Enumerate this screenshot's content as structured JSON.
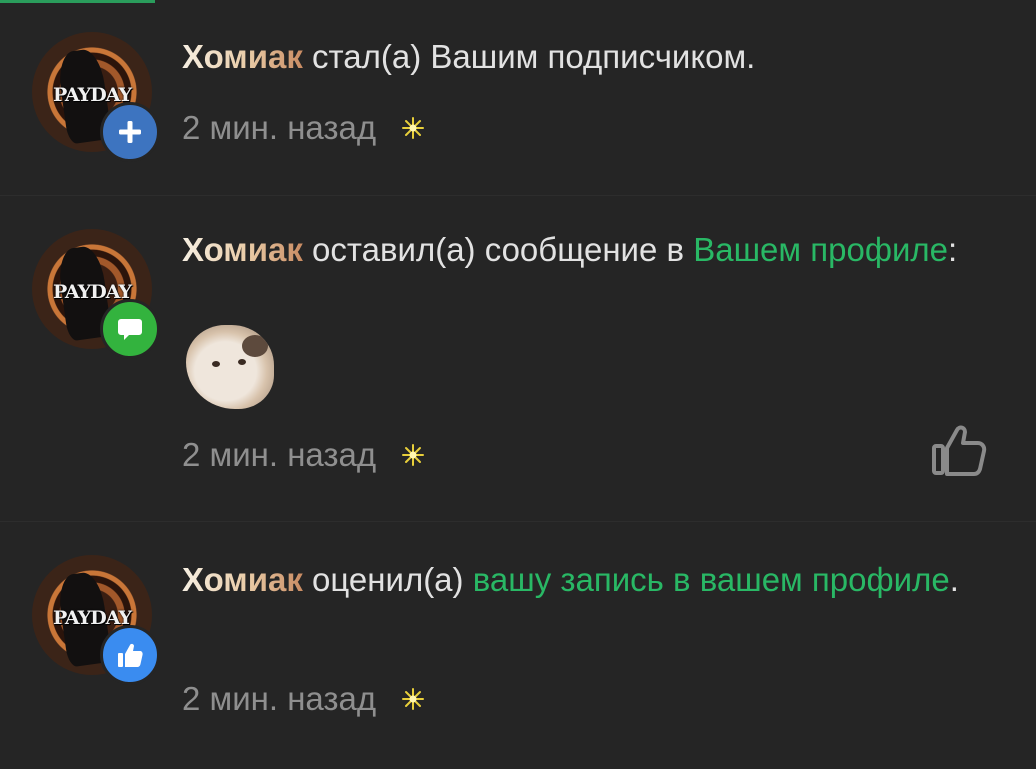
{
  "colors": {
    "background": "#252525",
    "link": "#29b865",
    "meta_text": "#8f8f8f",
    "follow_badge": "#3d74c0",
    "message_badge": "#33b33e",
    "like_badge": "#3a8cf0"
  },
  "notifications": [
    {
      "avatar_logo": "PAYDAY",
      "badge_icon": "plus-icon",
      "username": "Хомиак",
      "text": " стал(а) Вашим подписчиком.",
      "time": "2 мин. назад",
      "time_icon": "sparkle-icon"
    },
    {
      "avatar_logo": "PAYDAY",
      "badge_icon": "speech-bubble-icon",
      "username": "Хомиак",
      "text": " оставил(а) сообщение в ",
      "link_text": "Вашем профиле",
      "suffix": ":",
      "attachment": "hamster-sticker",
      "time": "2 мин. назад",
      "time_icon": "sparkle-icon",
      "action_icon": "thumbs-up-outline-icon"
    },
    {
      "avatar_logo": "PAYDAY",
      "badge_icon": "thumbs-up-icon",
      "username": "Хомиак",
      "text": " оценил(а) ",
      "link_text": "вашу запись в вашем профиле",
      "suffix": ".",
      "time": "2 мин. назад",
      "time_icon": "sparkle-icon"
    }
  ]
}
